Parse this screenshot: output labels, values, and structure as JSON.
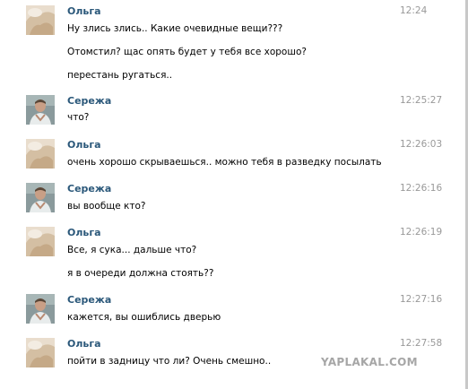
{
  "messages": [
    {
      "author": "Ольга",
      "avatar": "olga-avatar",
      "time": "12:24",
      "lines": [
        "Ну злись злись.. Какие очевидные вещи???",
        "Отомстил? щас опять будет у тебя все хорошо?",
        "перестань ругаться.."
      ]
    },
    {
      "author": "Сережа",
      "avatar": "serezha-avatar",
      "time": "12:25:27",
      "lines": [
        "что?"
      ]
    },
    {
      "author": "Ольга",
      "avatar": "olga-avatar",
      "time": "12:26:03",
      "lines": [
        "очень хорошо скрываешься.. можно тебя в разведку посылать"
      ]
    },
    {
      "author": "Сережа",
      "avatar": "serezha-avatar",
      "time": "12:26:16",
      "lines": [
        "вы вообще кто?"
      ]
    },
    {
      "author": "Ольга",
      "avatar": "olga-avatar",
      "time": "12:26:19",
      "lines": [
        "Все, я сука... дальше что?",
        "я в очереди должна стоять??"
      ]
    },
    {
      "author": "Сережа",
      "avatar": "serezha-avatar",
      "time": "12:27:16",
      "lines": [
        "кажется, вы ошиблись дверью"
      ]
    },
    {
      "author": "Ольга",
      "avatar": "olga-avatar",
      "time": "12:27:58",
      "lines": [
        "пойти в задницу что ли? Очень смешно.."
      ]
    }
  ],
  "watermark": "YAPLAKAL.COM"
}
